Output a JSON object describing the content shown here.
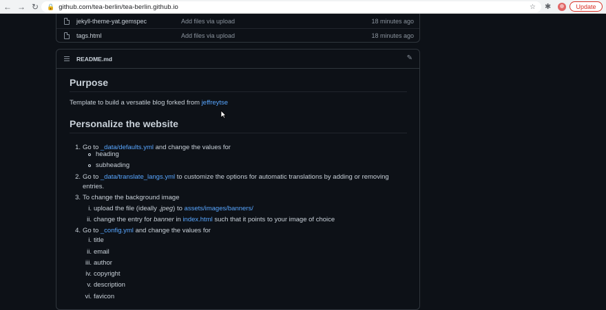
{
  "browser": {
    "url": "github.com/tea-berlin/tea-berlin.github.io",
    "update_label": "Update"
  },
  "files": [
    {
      "name": "jekyll-theme-yat.gemspec",
      "commit": "Add files via upload",
      "age": "18 minutes ago"
    },
    {
      "name": "tags.html",
      "commit": "Add files via upload",
      "age": "18 minutes ago"
    }
  ],
  "readme": {
    "title": "README.md",
    "h_purpose": "Purpose",
    "purpose_text": "Template to build a versatile blog forked from ",
    "purpose_link": "jeffreytse",
    "h_personalize": "Personalize the website",
    "items": {
      "i1_num": "1.",
      "i1_pre": "Go to ",
      "i1_link": "_data/defaults.yml",
      "i1_post": " and change the values for",
      "i1_sub1": "heading",
      "i1_sub2": "subheading",
      "i2_num": "2.",
      "i2_pre": "Go to ",
      "i2_link": "_data/translate_langs.yml",
      "i2_post": " to customize the options for automatic translations by adding or removing",
      "i2_cont": "entries.",
      "i3_num": "3.",
      "i3_text": "To change the background image",
      "i3_r1_num": "i.",
      "i3_r1_pre": "upload the file (ideally ",
      "i3_r1_em": ".jpeg",
      "i3_r1_mid": ") to ",
      "i3_r1_link": "assets/images/banners/",
      "i3_r2_num": "ii.",
      "i3_r2_pre": "change the entry for ",
      "i3_r2_em": "banner",
      "i3_r2_mid": " in ",
      "i3_r2_link": "index.html",
      "i3_r2_post": " such that it points to your image of choice",
      "i4_num": "4.",
      "i4_pre": "Go to ",
      "i4_link": "_config.yml",
      "i4_post": " and change the values for",
      "i4_subs": [
        {
          "num": "i.",
          "text": "title"
        },
        {
          "num": "ii.",
          "text": "email"
        },
        {
          "num": "iii.",
          "text": "author"
        },
        {
          "num": "iv.",
          "text": "copyright"
        },
        {
          "num": "v.",
          "text": "description"
        },
        {
          "num": "vi.",
          "text": "favicon"
        }
      ]
    }
  }
}
